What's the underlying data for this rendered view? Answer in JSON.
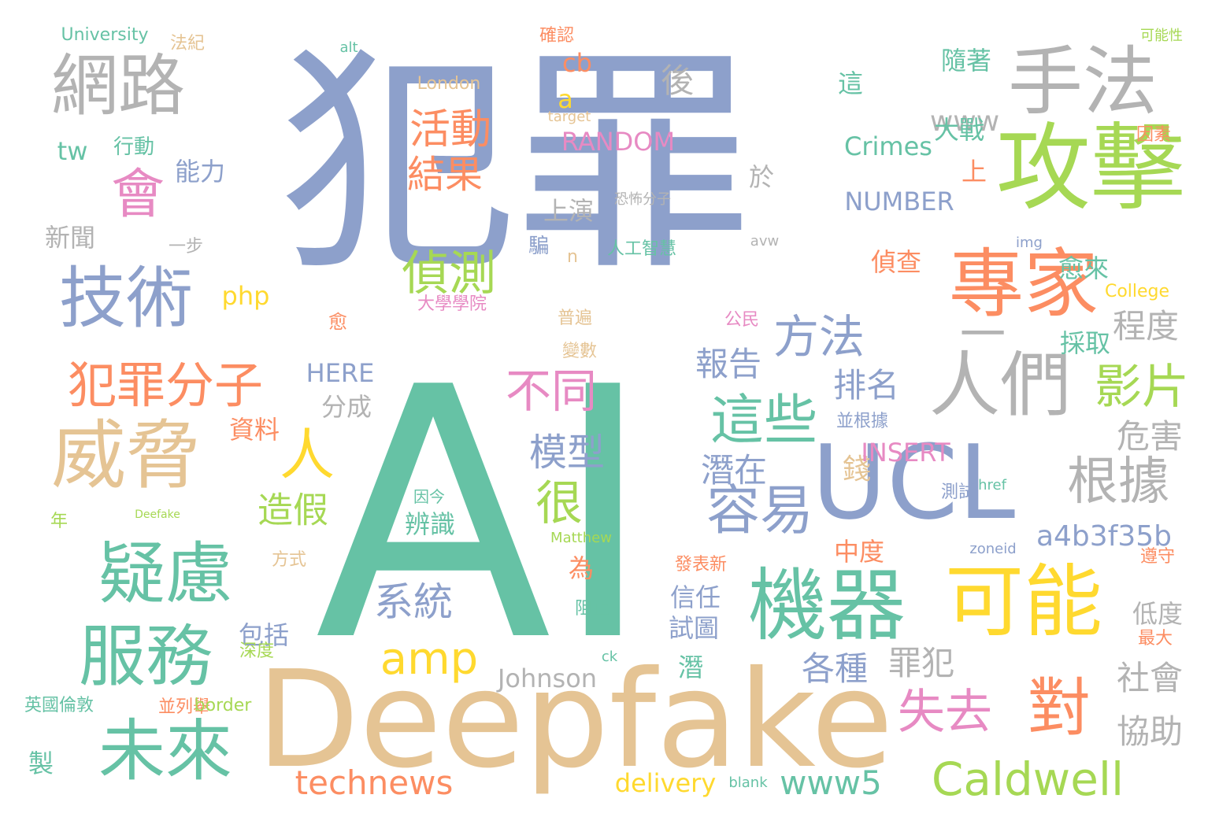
{
  "palette": {
    "blue": "#8da0cb",
    "teal": "#66c2a5",
    "orange": "#fc8d62",
    "gold": "#e5c494",
    "green": "#a6d854",
    "yellow": "#ffd92f",
    "pink": "#e78ac3",
    "gray": "#b3b3b3"
  },
  "words": [
    {
      "text": "犯罪",
      "color": "blue"
    },
    {
      "text": "AI",
      "color": "teal"
    },
    {
      "text": "Deepfake",
      "color": "gold"
    },
    {
      "text": "攻擊",
      "color": "green"
    },
    {
      "text": "專家",
      "color": "orange"
    },
    {
      "text": "UCL",
      "color": "blue"
    },
    {
      "text": "可能",
      "color": "yellow"
    },
    {
      "text": "機器",
      "color": "teal"
    },
    {
      "text": "手法",
      "color": "gray"
    },
    {
      "text": "網路",
      "color": "gray"
    },
    {
      "text": "技術",
      "color": "blue"
    },
    {
      "text": "威脅",
      "color": "gold"
    },
    {
      "text": "疑慮",
      "color": "teal"
    },
    {
      "text": "服務",
      "color": "teal"
    },
    {
      "text": "未來",
      "color": "teal"
    },
    {
      "text": "人們",
      "color": "gray"
    },
    {
      "text": "犯罪分子",
      "color": "orange"
    },
    {
      "text": "對",
      "color": "orange"
    },
    {
      "text": "會",
      "color": "pink"
    },
    {
      "text": "容易",
      "color": "blue"
    },
    {
      "text": "這些",
      "color": "teal"
    },
    {
      "text": "根據",
      "color": "gray"
    },
    {
      "text": "Caldwell",
      "color": "green"
    },
    {
      "text": "失去",
      "color": "pink"
    },
    {
      "text": "影片",
      "color": "green"
    },
    {
      "text": "偵測",
      "color": "green"
    },
    {
      "text": "活動",
      "color": "orange"
    },
    {
      "text": "結果",
      "color": "orange"
    },
    {
      "text": "amp",
      "color": "yellow"
    },
    {
      "text": "不同",
      "color": "pink"
    },
    {
      "text": "模型",
      "color": "blue"
    },
    {
      "text": "系統",
      "color": "blue"
    },
    {
      "text": "人",
      "color": "yellow"
    },
    {
      "text": "很",
      "color": "green"
    },
    {
      "text": "方法",
      "color": "blue"
    },
    {
      "text": "一",
      "color": "gray"
    },
    {
      "text": "www5",
      "color": "teal"
    },
    {
      "text": "technews",
      "color": "orange"
    },
    {
      "text": "造假",
      "color": "green"
    },
    {
      "text": "社會",
      "color": "gray"
    },
    {
      "text": "協助",
      "color": "gray"
    },
    {
      "text": "危害",
      "color": "gray"
    },
    {
      "text": "程度",
      "color": "gray"
    },
    {
      "text": "罪犯",
      "color": "gray"
    },
    {
      "text": "各種",
      "color": "blue"
    },
    {
      "text": "報告",
      "color": "blue"
    },
    {
      "text": "潛在",
      "color": "blue"
    },
    {
      "text": "排名",
      "color": "blue"
    },
    {
      "text": "錢",
      "color": "gold"
    },
    {
      "text": "a4b3f35b",
      "color": "blue"
    },
    {
      "text": "Johnson",
      "color": "gray"
    },
    {
      "text": "delivery",
      "color": "yellow"
    },
    {
      "text": "後",
      "color": "gray"
    },
    {
      "text": "www",
      "color": "gray"
    },
    {
      "text": "Crimes",
      "color": "teal"
    },
    {
      "text": "RANDOM",
      "color": "pink"
    },
    {
      "text": "NUMBER",
      "color": "blue"
    },
    {
      "text": "INSERT",
      "color": "pink"
    },
    {
      "text": "HERE",
      "color": "blue"
    },
    {
      "text": "大戰",
      "color": "teal"
    },
    {
      "text": "隨著",
      "color": "teal"
    },
    {
      "text": "上演",
      "color": "gray"
    },
    {
      "text": "tw",
      "color": "teal"
    },
    {
      "text": "能力",
      "color": "blue"
    },
    {
      "text": "新聞",
      "color": "gray"
    },
    {
      "text": "php",
      "color": "yellow"
    },
    {
      "text": "a",
      "color": "yellow"
    },
    {
      "text": "cb",
      "color": "orange"
    },
    {
      "text": "資料",
      "color": "orange"
    },
    {
      "text": "分成",
      "color": "gray"
    },
    {
      "text": "包括",
      "color": "blue"
    },
    {
      "text": "為",
      "color": "orange"
    },
    {
      "text": "潛",
      "color": "teal"
    },
    {
      "text": "辨識",
      "color": "teal"
    },
    {
      "text": "信任",
      "color": "blue"
    },
    {
      "text": "試圖",
      "color": "blue"
    },
    {
      "text": "中度",
      "color": "orange"
    },
    {
      "text": "偵查",
      "color": "orange"
    },
    {
      "text": "愈來",
      "color": "teal"
    },
    {
      "text": "採取",
      "color": "teal"
    },
    {
      "text": "低度",
      "color": "gray"
    },
    {
      "text": "製",
      "color": "teal"
    },
    {
      "text": "這",
      "color": "teal"
    },
    {
      "text": "上",
      "color": "orange"
    },
    {
      "text": "於",
      "color": "gray"
    },
    {
      "text": "行動",
      "color": "teal"
    },
    {
      "text": "University",
      "color": "teal"
    },
    {
      "text": "法紀",
      "color": "gold"
    },
    {
      "text": "London",
      "color": "gold"
    },
    {
      "text": "確認",
      "color": "orange"
    },
    {
      "text": "人工智慧",
      "color": "teal"
    },
    {
      "text": "騙",
      "color": "blue"
    },
    {
      "text": "n",
      "color": "gold"
    },
    {
      "text": "愈",
      "color": "orange"
    },
    {
      "text": "普遍",
      "color": "gold"
    },
    {
      "text": "變數",
      "color": "gold"
    },
    {
      "text": "阻止",
      "color": "teal"
    },
    {
      "text": "深度",
      "color": "green"
    },
    {
      "text": "英國倫敦",
      "color": "teal"
    },
    {
      "text": "並列舉",
      "color": "orange"
    },
    {
      "text": "border",
      "color": "green"
    },
    {
      "text": "測試",
      "color": "blue"
    },
    {
      "text": "zoneid",
      "color": "blue"
    },
    {
      "text": "href",
      "color": "teal"
    },
    {
      "text": "img",
      "color": "blue"
    },
    {
      "text": "College",
      "color": "yellow"
    },
    {
      "text": "遵守",
      "color": "orange"
    },
    {
      "text": "最大",
      "color": "orange"
    },
    {
      "text": "發表新",
      "color": "orange"
    },
    {
      "text": "blank",
      "color": "teal"
    },
    {
      "text": "ck",
      "color": "teal"
    },
    {
      "text": "方式",
      "color": "gold"
    },
    {
      "text": "年",
      "color": "green"
    },
    {
      "text": "一步",
      "color": "gray"
    },
    {
      "text": "大學學院",
      "color": "pink"
    },
    {
      "text": "公民",
      "color": "pink"
    },
    {
      "text": "並根據",
      "color": "blue"
    },
    {
      "text": "因素",
      "color": "orange"
    },
    {
      "text": "可能性",
      "color": "green"
    },
    {
      "text": "alt",
      "color": "teal"
    },
    {
      "text": "target",
      "color": "gold"
    },
    {
      "text": "avw",
      "color": "gray"
    },
    {
      "text": "恐怖分子",
      "color": "gray"
    },
    {
      "text": "Matthew",
      "color": "green"
    },
    {
      "text": "Deefake",
      "color": "green"
    },
    {
      "text": "因今",
      "color": "teal"
    }
  ]
}
